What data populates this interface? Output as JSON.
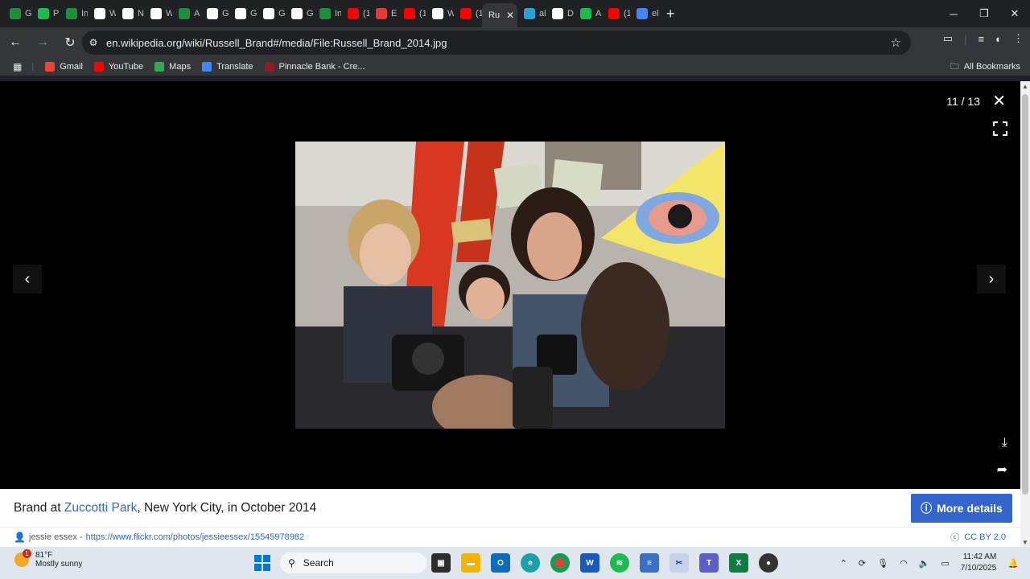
{
  "browser": {
    "tabs": [
      {
        "label": "Gi",
        "icon": "wikiwand-icon",
        "color": "#1e8e3e"
      },
      {
        "label": "P",
        "icon": "green-a-icon",
        "color": "#1db954"
      },
      {
        "label": "In",
        "icon": "wikiwand-icon",
        "color": "#1e8e3e"
      },
      {
        "label": "W",
        "icon": "wikipedia-icon",
        "color": "#ffffff"
      },
      {
        "label": "N",
        "icon": "wikipedia-icon",
        "color": "#ffffff"
      },
      {
        "label": "W",
        "icon": "wikipedia-icon",
        "color": "#ffffff"
      },
      {
        "label": "Al",
        "icon": "wikiwand-icon",
        "color": "#1e8e3e"
      },
      {
        "label": "Gi",
        "icon": "wikipedia-icon",
        "color": "#ffffff"
      },
      {
        "label": "Gi",
        "icon": "wikipedia-icon",
        "color": "#ffffff"
      },
      {
        "label": "Gi",
        "icon": "wikipedia-icon",
        "color": "#ffffff"
      },
      {
        "label": "Gi",
        "icon": "wikipedia-icon",
        "color": "#ffffff"
      },
      {
        "label": "In",
        "icon": "wikiwand-icon",
        "color": "#1e8e3e"
      },
      {
        "label": "(1",
        "icon": "youtube-icon",
        "color": "#ff0000"
      },
      {
        "label": "El",
        "icon": "red-square-icon",
        "color": "#e53935"
      },
      {
        "label": "(1",
        "icon": "youtube-icon",
        "color": "#ff0000"
      },
      {
        "label": "W",
        "icon": "flickr-icon",
        "color": "#ffffff"
      },
      {
        "label": "(1",
        "icon": "youtube-icon",
        "color": "#ff0000"
      }
    ],
    "active_tab": {
      "label": "Ru",
      "close": "✕"
    },
    "tabs_after": [
      {
        "label": "al",
        "icon": "edge-icon",
        "color": "#2b9fd6"
      },
      {
        "label": "D",
        "icon": "wikipedia-icon",
        "color": "#ffffff"
      },
      {
        "label": "A",
        "icon": "green-a-icon",
        "color": "#1db954"
      },
      {
        "label": "(1",
        "icon": "youtube-icon",
        "color": "#ff0000"
      },
      {
        "label": "el",
        "icon": "google-icon",
        "color": "#4285f4"
      }
    ],
    "new_tab": "+",
    "url": "en.wikipedia.org/wiki/Russell_Brand#/media/File:Russell_Brand_2014.jpg",
    "bookmarks": [
      {
        "label": "Gmail",
        "icon": "gmail-icon",
        "color": "#ea4335"
      },
      {
        "label": "YouTube",
        "icon": "youtube-icon",
        "color": "#ff0000"
      },
      {
        "label": "Maps",
        "icon": "maps-icon",
        "color": "#34a853"
      },
      {
        "label": "Translate",
        "icon": "translate-icon",
        "color": "#4285f4"
      },
      {
        "label": "Pinnacle Bank - Cre...",
        "icon": "bank-icon",
        "color": "#8a1c2b"
      }
    ],
    "all_bookmarks": "All Bookmarks"
  },
  "viewer": {
    "counter": "11 / 13",
    "caption_prefix": "Brand at ",
    "caption_link": "Zuccotti Park",
    "caption_suffix": ", New York City, in October 2014",
    "more_details": "More details",
    "author": "jessie essex -",
    "author_link": "https://www.flickr.com/photos/jessieessex/15545978982",
    "license": "CC BY 2.0"
  },
  "taskbar": {
    "weather_temp": "81°F",
    "weather_desc": "Mostly sunny",
    "weather_badge": "1",
    "search": "Search",
    "time": "11:42 AM",
    "date": "7/10/2025"
  }
}
